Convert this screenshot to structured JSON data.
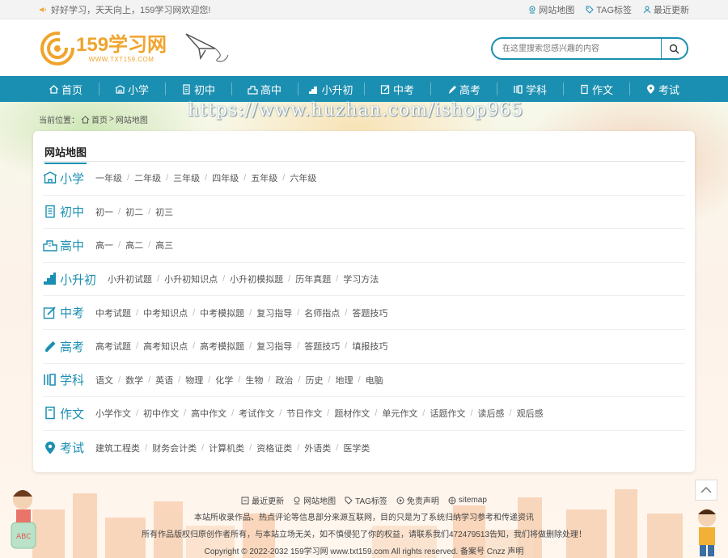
{
  "topbar": {
    "welcome": "好好学习，天天向上，159学习网欢迎您!",
    "links": [
      {
        "label": "网站地图",
        "icon": "pin-icon"
      },
      {
        "label": "TAG标签",
        "icon": "tag-icon"
      },
      {
        "label": "最近更新",
        "icon": "user-icon"
      }
    ]
  },
  "logo": {
    "title": "159学习网",
    "url": "WWW.TXT159.COM"
  },
  "search": {
    "placeholder": "在这里搜索您感兴趣的内容"
  },
  "nav": [
    {
      "label": "首页",
      "icon": "home-icon"
    },
    {
      "label": "小学",
      "icon": "school-icon"
    },
    {
      "label": "初中",
      "icon": "building-icon"
    },
    {
      "label": "高中",
      "icon": "city-icon"
    },
    {
      "label": "小升初",
      "icon": "stairs-icon"
    },
    {
      "label": "中考",
      "icon": "edit-icon"
    },
    {
      "label": "高考",
      "icon": "pen-icon"
    },
    {
      "label": "学科",
      "icon": "book-icon"
    },
    {
      "label": "作文",
      "icon": "document-icon"
    },
    {
      "label": "考试",
      "icon": "location-icon"
    }
  ],
  "watermark": "https://www.huzhan.com/ishop965",
  "breadcrumb": {
    "prefix": "当前位置：",
    "home": "首页",
    "sep": ">",
    "current": "网站地图"
  },
  "sitemap": {
    "title": "网站地图",
    "rows": [
      {
        "label": "小学",
        "icon": "school-icon",
        "links": [
          "一年级",
          "二年级",
          "三年级",
          "四年级",
          "五年级",
          "六年级"
        ]
      },
      {
        "label": "初中",
        "icon": "building-icon",
        "links": [
          "初一",
          "初二",
          "初三"
        ]
      },
      {
        "label": "高中",
        "icon": "city-icon",
        "links": [
          "高一",
          "高二",
          "高三"
        ]
      },
      {
        "label": "小升初",
        "icon": "stairs-icon",
        "links": [
          "小升初试题",
          "小升初知识点",
          "小升初模拟题",
          "历年真题",
          "学习方法"
        ]
      },
      {
        "label": "中考",
        "icon": "edit-icon",
        "links": [
          "中考试题",
          "中考知识点",
          "中考模拟题",
          "复习指导",
          "名师指点",
          "答题技巧"
        ]
      },
      {
        "label": "高考",
        "icon": "pen-icon",
        "links": [
          "高考试题",
          "高考知识点",
          "高考模拟题",
          "复习指导",
          "答题技巧",
          "填报技巧"
        ]
      },
      {
        "label": "学科",
        "icon": "book-icon",
        "links": [
          "语文",
          "数学",
          "英语",
          "物理",
          "化学",
          "生物",
          "政治",
          "历史",
          "地理",
          "电脑"
        ]
      },
      {
        "label": "作文",
        "icon": "document-icon",
        "links": [
          "小学作文",
          "初中作文",
          "高中作文",
          "考试作文",
          "节日作文",
          "题材作文",
          "单元作文",
          "话题作文",
          "读后感",
          "观后感"
        ]
      },
      {
        "label": "考试",
        "icon": "location-icon",
        "links": [
          "建筑工程类",
          "财务会计类",
          "计算机类",
          "资格证类",
          "外语类",
          "医学类"
        ]
      }
    ]
  },
  "footer": {
    "links": [
      {
        "label": "最近更新",
        "icon": "update-icon"
      },
      {
        "label": "网站地图",
        "icon": "pin-icon"
      },
      {
        "label": "TAG标签",
        "icon": "tag-icon"
      },
      {
        "label": "免责声明",
        "icon": "disclaimer-icon"
      },
      {
        "label": "sitemap",
        "icon": "sitemap-icon"
      }
    ],
    "line1": "本站所收录作品、热点评论等信息部分来源互联网，目的只是为了系统归纳学习参考和传递资讯",
    "line2": "所有作品版权归原创作者所有，与本站立场无关，如不慎侵犯了你的权益，请联系我们472479513告知，我们将做删除处理！",
    "copyright": "Copyright © 2022-2032 159学习网 www.txt159.com All rights reserved. 备案号 Cnzz 声明"
  },
  "colors": {
    "accent": "#1b8fb1",
    "logo": "#f0a42d"
  }
}
